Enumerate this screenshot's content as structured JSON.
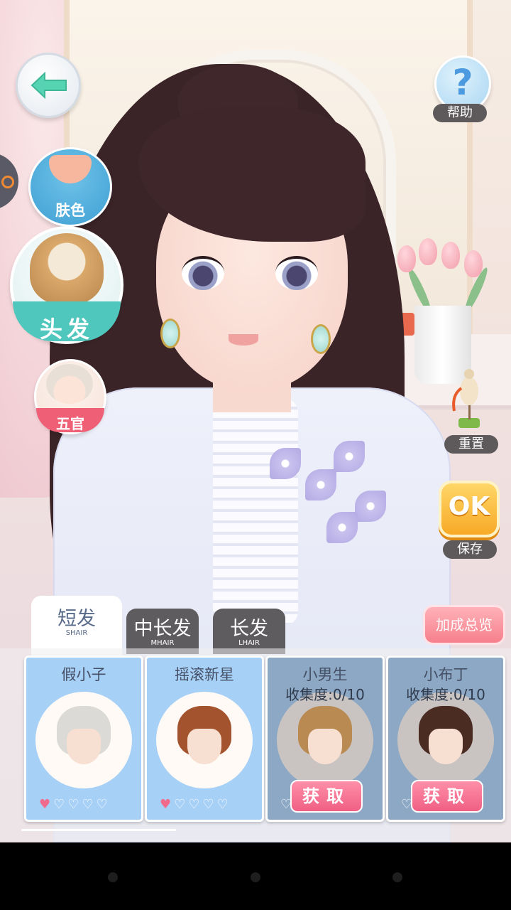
{
  "left_menu": {
    "skin_label": "肤色",
    "hair_label": "头发",
    "features_label": "五官"
  },
  "right_menu": {
    "help_symbol": "?",
    "help_label": "帮助",
    "reset_label": "重置",
    "ok_label": "OK",
    "save_label": "保存"
  },
  "tabs": [
    {
      "label": "短发",
      "sub": "SHAIR",
      "active": true
    },
    {
      "label": "中长发",
      "sub": "MHAIR",
      "active": false
    },
    {
      "label": "长发",
      "sub": "LHAIR",
      "active": false
    }
  ],
  "bonus_button": "加成总览",
  "items": [
    {
      "name": "假小子",
      "collect": "",
      "locked": false,
      "hearts_filled": 1,
      "hair_color": "#dcdad6",
      "action": ""
    },
    {
      "name": "摇滚新星",
      "collect": "",
      "locked": false,
      "hearts_filled": 1,
      "hair_color": "#a4532f",
      "action": ""
    },
    {
      "name": "小男生",
      "collect": "收集度:0/10",
      "locked": true,
      "hearts_filled": 0,
      "hair_color": "#b98a52",
      "action": "获取"
    },
    {
      "name": "小布丁",
      "collect": "收集度:0/10",
      "locked": true,
      "hearts_filled": 0,
      "hair_color": "#4a2c22",
      "action": "获取"
    }
  ],
  "colors": {
    "accent_teal": "#4fc7bd",
    "accent_pink": "#ef5f76",
    "card_blue": "#a7d0f6",
    "ok_orange": "#f7a723"
  }
}
